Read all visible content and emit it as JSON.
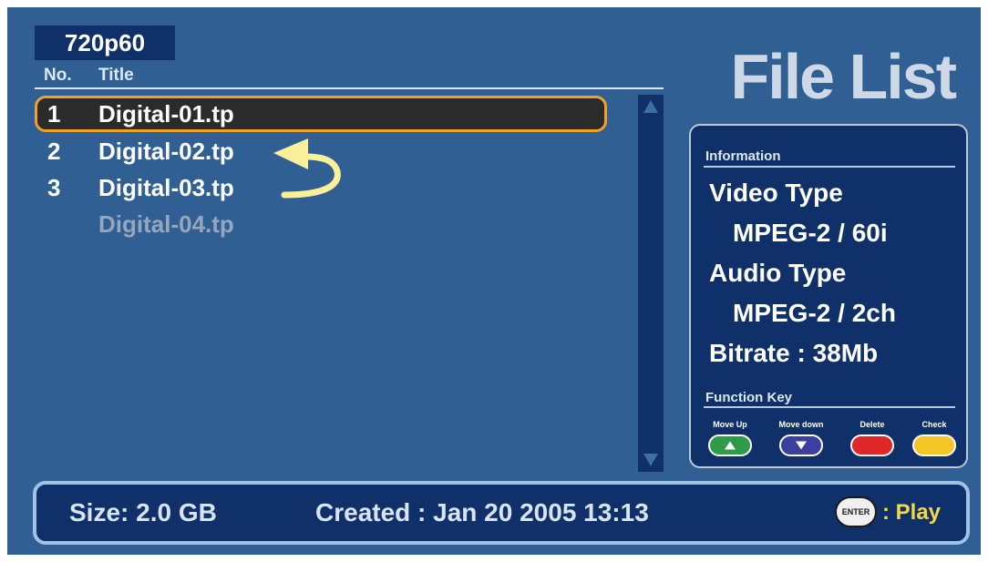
{
  "format_badge": "720p60",
  "list": {
    "col_no": "No.",
    "col_title": "Title",
    "items": [
      {
        "no": "1",
        "title": "Digital-01.tp",
        "state": "selected"
      },
      {
        "no": "2",
        "title": "Digital-02.tp",
        "state": "normal"
      },
      {
        "no": "3",
        "title": "Digital-03.tp",
        "state": "normal"
      },
      {
        "no": "",
        "title": "Digital-04.tp",
        "state": "dimmed"
      }
    ]
  },
  "screen_title": "File List",
  "info": {
    "section": "Information",
    "video_label": "Video Type",
    "video_value": "MPEG-2 / 60i",
    "audio_label": "Audio Type",
    "audio_value": "MPEG-2 / 2ch",
    "bitrate": "Bitrate : 38Mb"
  },
  "function_keys": {
    "section": "Function Key",
    "keys": [
      {
        "label": "Move Up",
        "color": "#2f9a48",
        "icon": "up-triangle-icon"
      },
      {
        "label": "Move down",
        "color": "#3a3fa0",
        "icon": "down-triangle-icon"
      },
      {
        "label": "Delete",
        "color": "#e02828",
        "icon": ""
      },
      {
        "label": "Check",
        "color": "#f5c527",
        "icon": ""
      }
    ]
  },
  "status": {
    "size": "Size: 2.0 GB",
    "created": "Created : Jan 20 2005 13:13",
    "enter_key": "ENTER",
    "action": ": Play"
  },
  "colors": {
    "background": "#2f5f93",
    "panel": "#10306a",
    "highlight_border": "#f2a126",
    "arrow": "#fbef9a",
    "play": "#f3d84a"
  }
}
